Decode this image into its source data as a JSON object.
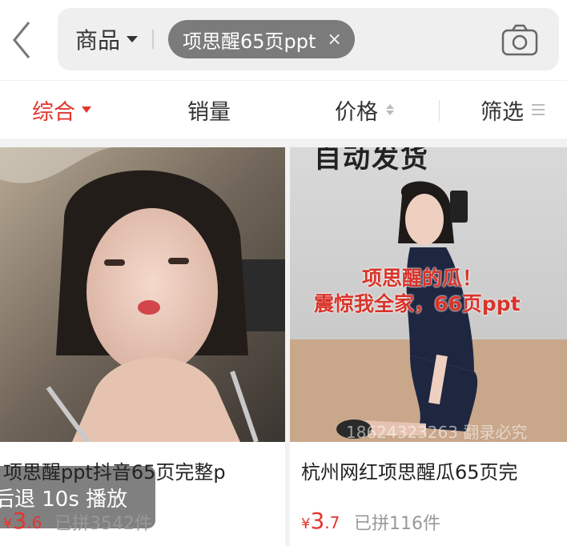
{
  "search": {
    "scope_label": "商品",
    "query_chip": "项思醒65页ppt",
    "chip_close": "×"
  },
  "tabs": [
    {
      "label": "综合",
      "active": true
    },
    {
      "label": "销量",
      "active": false
    },
    {
      "label": "价格",
      "active": false
    },
    {
      "label": "筛选",
      "active": false
    }
  ],
  "products": [
    {
      "title": "项思醒ppt抖音65页完整p",
      "price_currency": "¥",
      "price_int": "3",
      "price_dec": ".6",
      "sold": "已拼3542件",
      "overlay": "后退 10s 播放"
    },
    {
      "title": "杭州网红项思醒瓜65页完",
      "price_currency": "¥",
      "price_int": "3",
      "price_dec": ".7",
      "sold": "已拼116件",
      "image_text_top": "自动发货",
      "image_text_red_1": "项思醒的瓜！",
      "image_text_red_2": "震惊我全家，66页ppt",
      "watermark": "18624323263 翻录必究"
    }
  ],
  "colors": {
    "accent": "#e4352d",
    "chip_bg": "#7b7b7b",
    "search_bg": "#efefef"
  },
  "icons": [
    "back-chevron-icon",
    "dropdown-caret-icon",
    "close-icon",
    "camera-icon",
    "sort-arrows-icon",
    "filter-lines-icon"
  ]
}
